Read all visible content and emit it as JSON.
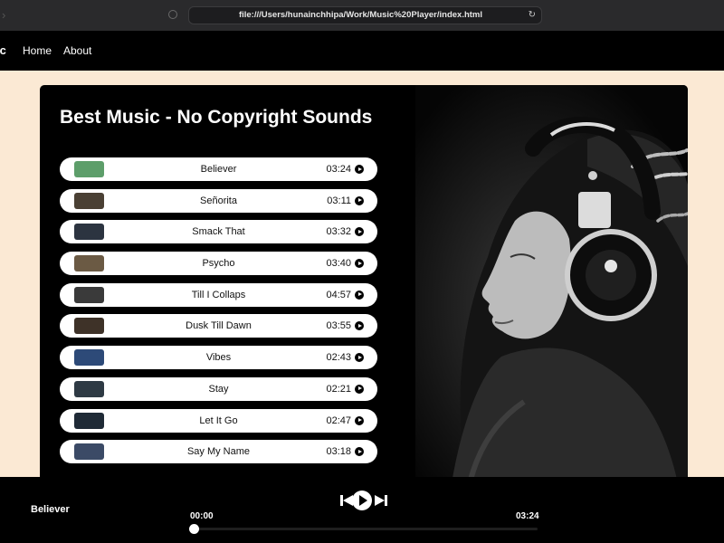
{
  "browser": {
    "url": "file:///Users/hunainchhipa/Work/Music%20Player/index.html"
  },
  "nav": {
    "brand": "ic",
    "links": [
      "Home",
      "About"
    ]
  },
  "main": {
    "title": "Best Music - No Copyright Sounds",
    "songs": [
      {
        "name": "Believer",
        "duration": "03:24",
        "thumb": "#5d9e6a"
      },
      {
        "name": "Señorita",
        "duration": "03:11",
        "thumb": "#4a4034"
      },
      {
        "name": "Smack That",
        "duration": "03:32",
        "thumb": "#2c3440"
      },
      {
        "name": "Psycho",
        "duration": "03:40",
        "thumb": "#6b5a44"
      },
      {
        "name": "Till I Collaps",
        "duration": "04:57",
        "thumb": "#3a3a3a"
      },
      {
        "name": "Dusk Till Dawn",
        "duration": "03:55",
        "thumb": "#3e3228"
      },
      {
        "name": "Vibes",
        "duration": "02:43",
        "thumb": "#2d4a78"
      },
      {
        "name": "Stay",
        "duration": "02:21",
        "thumb": "#2e3a44"
      },
      {
        "name": "Let It Go",
        "duration": "02:47",
        "thumb": "#1f2a36"
      },
      {
        "name": "Say My Name",
        "duration": "03:18",
        "thumb": "#3b4a66"
      }
    ]
  },
  "player": {
    "now_playing": "Believer",
    "current_time": "00:00",
    "total_time": "03:24",
    "progress": 0
  }
}
